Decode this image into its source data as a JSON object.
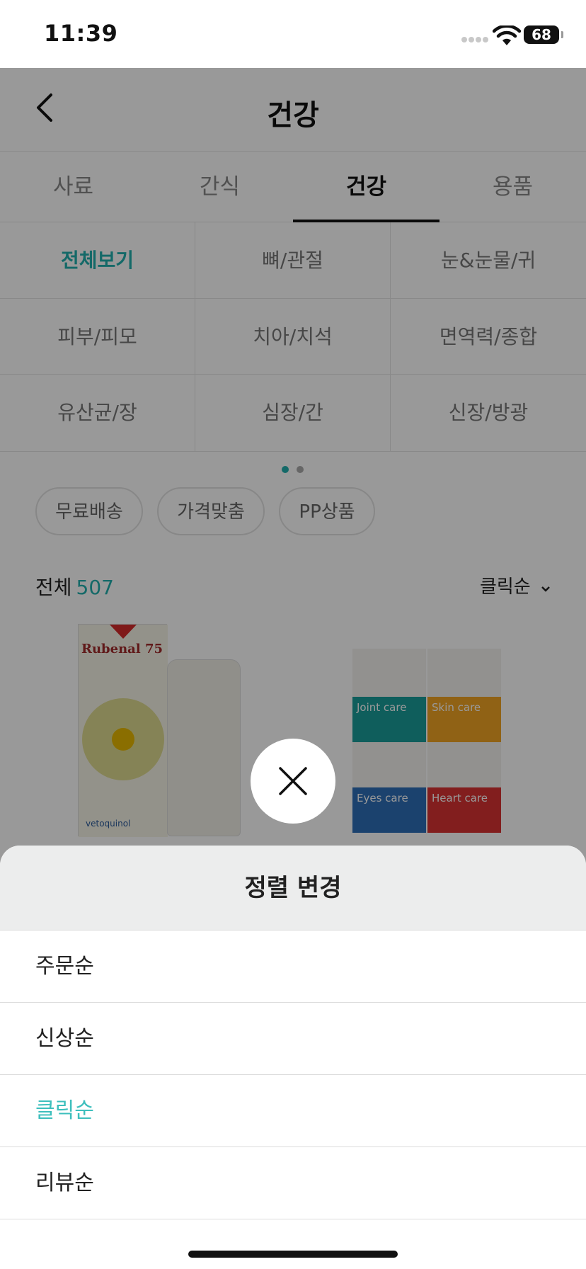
{
  "status_bar": {
    "time": "11:39",
    "battery": "68"
  },
  "header": {
    "title": "건강"
  },
  "tabs": [
    {
      "label": "사료"
    },
    {
      "label": "간식"
    },
    {
      "label": "건강",
      "active": true
    },
    {
      "label": "용품"
    }
  ],
  "subcategories": [
    {
      "label": "전체보기",
      "active": true
    },
    {
      "label": "뼈/관절"
    },
    {
      "label": "눈&눈물/귀"
    },
    {
      "label": "피부/피모"
    },
    {
      "label": "치아/치석"
    },
    {
      "label": "면역력/종합"
    },
    {
      "label": "유산균/장"
    },
    {
      "label": "심장/간"
    },
    {
      "label": "신장/방광"
    }
  ],
  "filters": [
    {
      "label": "무료배송"
    },
    {
      "label": "가격맞춤"
    },
    {
      "label": "PP상품"
    }
  ],
  "listing": {
    "total_label": "전체",
    "total_count": "507",
    "sort_label": "클릭순"
  },
  "products": [
    {
      "brand_text": "Rubenal 75",
      "maker": "vetoquinol"
    },
    {
      "panels": [
        "Joint care",
        "Skin care",
        "Eyes care",
        "Heart care"
      ]
    }
  ],
  "sort_sheet": {
    "title": "정렬 변경",
    "options": [
      {
        "label": "주문순"
      },
      {
        "label": "신상순"
      },
      {
        "label": "클릭순",
        "selected": true
      },
      {
        "label": "리뷰순"
      }
    ]
  },
  "colors": {
    "accent": "#22b0ad",
    "selected_option": "#3dbfbd"
  },
  "icons": [
    "back-icon",
    "close-icon",
    "chevron-down-icon",
    "wifi-icon",
    "battery-icon"
  ]
}
